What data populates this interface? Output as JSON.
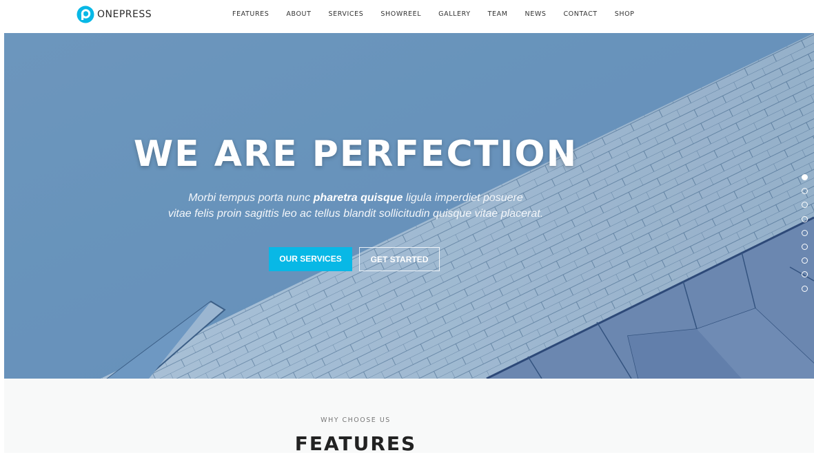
{
  "header": {
    "logo_text": "ONEPRESS",
    "logo_icon": "onepress-logo-icon",
    "nav": [
      "FEATURES",
      "ABOUT",
      "SERVICES",
      "SHOWREEL",
      "GALLERY",
      "TEAM",
      "NEWS",
      "CONTACT",
      "SHOP"
    ]
  },
  "hero": {
    "title": "WE ARE PERFECTION",
    "subtitle_part1": "Morbi tempus porta nunc ",
    "subtitle_bold": "pharetra quisque",
    "subtitle_part2": " ligula imperdiet posuere",
    "subtitle_line2": "vitae felis proin sagittis leo ac tellus blandit sollicitudin quisque vitae placerat.",
    "primary_button": "OUR SERVICES",
    "secondary_button": "GET STARTED",
    "section_nav": {
      "count": 9,
      "active_index": 0
    }
  },
  "features": {
    "kicker": "WHY CHOOSE US",
    "title": "FEATURES"
  },
  "colors": {
    "accent": "#08b8e6",
    "hero_tint": "#6e98bf",
    "section_bg": "#f8f9f9"
  }
}
